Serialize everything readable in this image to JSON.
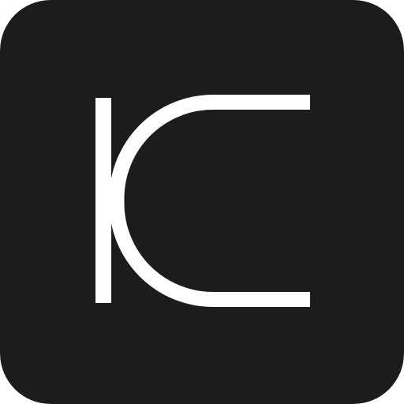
{
  "app_icon": {
    "logo_name": "kc-monogram-logo",
    "background_color": "#1c1c1c",
    "glyph_color": "#ffffff",
    "corner_style": "rounded-square"
  }
}
